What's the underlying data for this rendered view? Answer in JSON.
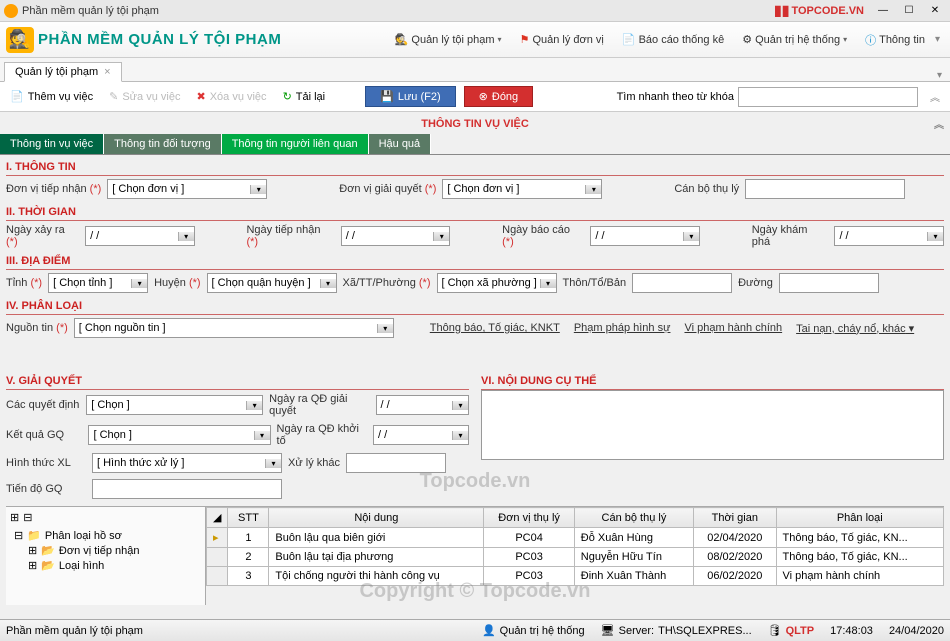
{
  "window": {
    "title": "Phần mềm quản lý tội phạm",
    "brand": "TOPCODE.VN"
  },
  "header": {
    "app_title": "PHẦN MỀM QUẢN LÝ TỘI PHẠM"
  },
  "menus": [
    {
      "label": "Quản lý tội phạm",
      "icon": "detective-icon"
    },
    {
      "label": "Quản lý đơn vị",
      "icon": "flag-icon"
    },
    {
      "label": "Báo cáo thống kê",
      "icon": "report-icon"
    },
    {
      "label": "Quản trị hệ thống",
      "icon": "gear-icon"
    },
    {
      "label": "Thông tin",
      "icon": "info-icon"
    }
  ],
  "doctab": {
    "label": "Quản lý tội phạm"
  },
  "toolbar": {
    "add": "Thêm vụ việc",
    "edit": "Sửa vụ việc",
    "del": "Xóa vụ việc",
    "reload": "Tải lại",
    "save": "Lưu  (F2)",
    "close": "Đóng",
    "search_label": "Tìm nhanh theo từ khóa"
  },
  "section_title": "THÔNG TIN VỤ VIỆC",
  "subtabs": [
    "Thông tin vụ việc",
    "Thông tin đối tượng",
    "Thông tin người liên quan",
    "Hậu quả"
  ],
  "group1": {
    "head": "I. THÔNG TIN",
    "l_recv": "Đơn vị tiếp nhận",
    "v_recv": "[ Chọn đơn vị ]",
    "l_solve": "Đơn vị giải quyết",
    "v_solve": "[ Chọn đơn vị ]",
    "l_officer": "Cán bộ thụ lý"
  },
  "group2": {
    "head": "II. THỜI GIAN",
    "l_happen": "Ngày xảy ra",
    "l_recv": "Ngày tiếp nhận",
    "l_report": "Ngày báo cáo",
    "l_discover": "Ngày khám phá",
    "date_placeholder": "/  /"
  },
  "group3": {
    "head": "III. ĐỊA ĐIỂM",
    "l_prov": "Tỉnh",
    "v_prov": "[ Chọn tỉnh ]",
    "l_dist": "Huyện",
    "v_dist": "[ Chọn quận huyện ]",
    "l_ward": "Xã/TT/Phường",
    "v_ward": "[ Chọn xã phường ]",
    "l_hamlet": "Thôn/Tổ/Bản",
    "l_street": "Đường"
  },
  "group4": {
    "head": "IV. PHÂN LOẠI",
    "l_src": "Nguồn tin",
    "v_src": "[ Chọn nguồn tin ]",
    "links": [
      "Thông báo, Tố giác, KNKT",
      "Phạm pháp hình sự",
      "Vi phạm hành chính",
      "Tai nạn, cháy nổ, khác"
    ]
  },
  "group5": {
    "head": "V. GIẢI QUYẾT",
    "l_dec": "Các quyết định",
    "v_dec": "[ Chọn ]",
    "l_res": "Kết quả GQ",
    "v_res": "[ Chọn ]",
    "l_form": "Hình thức XL",
    "v_form": "[ Hình thức xử lý ]",
    "l_prog": "Tiến độ GQ",
    "l_qdgq": "Ngày ra QĐ giải quyết",
    "l_qdkt": "Ngày ra QĐ khởi tố",
    "l_other": "Xử lý khác"
  },
  "group6": {
    "head": "VI. NỘI DUNG CỤ THỂ"
  },
  "tree": {
    "root": "Phân loại hồ sơ",
    "c1": "Đơn vị tiếp nhận",
    "c2": "Loại hình"
  },
  "grid": {
    "cols": [
      "STT",
      "Nội dung",
      "Đơn vị thụ lý",
      "Cán bộ thụ lý",
      "Thời gian",
      "Phân loại"
    ],
    "rows": [
      {
        "stt": "1",
        "nd": "Buôn lậu qua biên giới",
        "dv": "PC04",
        "cb": "Đỗ Xuân Hùng",
        "tg": "02/04/2020",
        "pl": "Thông báo, Tố giác, KN..."
      },
      {
        "stt": "2",
        "nd": "Buôn lậu tại địa phương",
        "dv": "PC03",
        "cb": "Nguyễn Hữu Tín",
        "tg": "08/02/2020",
        "pl": "Thông báo, Tố giác, KN..."
      },
      {
        "stt": "3",
        "nd": "Tội chống người thi hành công vụ",
        "dv": "PC03",
        "cb": "Đinh Xuân Thành",
        "tg": "06/02/2020",
        "pl": "Vi phạm hành chính"
      }
    ]
  },
  "status": {
    "app": "Phần mềm quản lý tội phạm",
    "user_label": "Quản trị hệ thống",
    "server_label": "Server:",
    "server": "TH\\SQLEXPRES...",
    "db": "QLTP",
    "time": "17:48:03",
    "date": "24/04/2020"
  },
  "watermark": "Topcode.vn",
  "watermark2": "Copyright © Topcode.vn"
}
